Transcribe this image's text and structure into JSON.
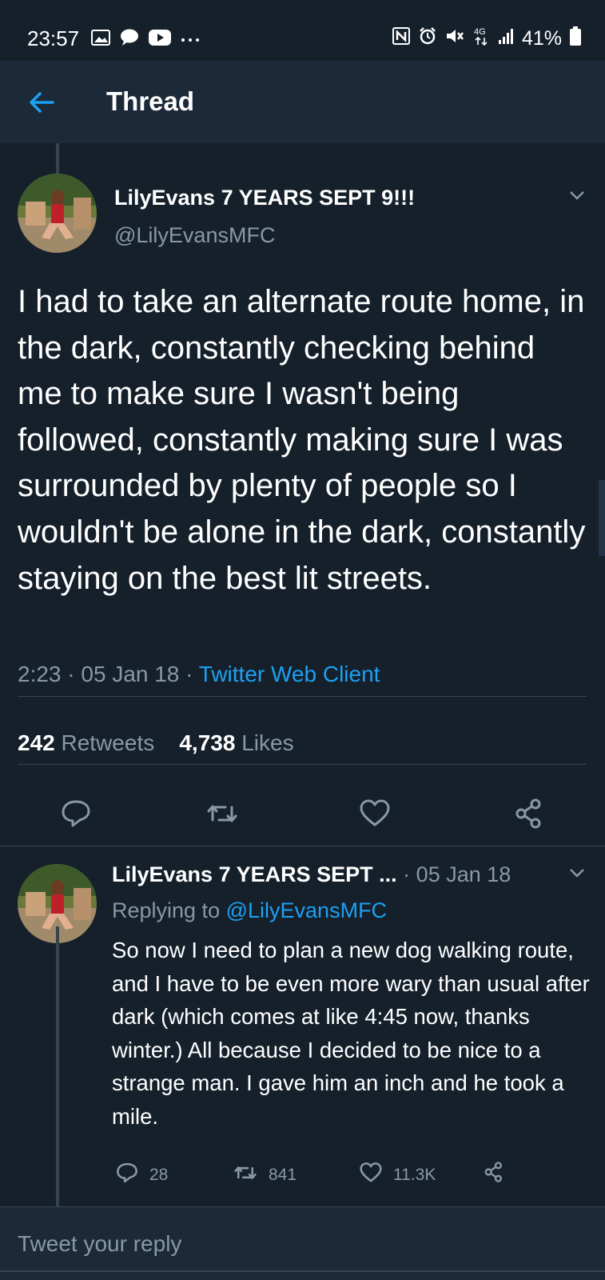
{
  "status_bar": {
    "time": "23:57",
    "left_icons": [
      "image-icon",
      "chat-bubble-icon",
      "youtube-icon",
      "more-icon"
    ],
    "right_icons": [
      "nfc-icon",
      "alarm-icon",
      "mute-icon",
      "4g-icon",
      "signal-icon",
      "battery-icon"
    ],
    "battery": "41%"
  },
  "header": {
    "title": "Thread",
    "accent_color": "#1da1f2"
  },
  "main_tweet": {
    "display_name": "LilyEvans 7 YEARS SEPT 9!!!",
    "handle": "@LilyEvansMFC",
    "text": "I had to take an alternate route home, in the dark, constantly checking behind me to make sure I wasn't being followed, constantly making sure I was surrounded by plenty of people so I wouldn't be alone in the dark, constantly staying on the best lit streets.",
    "time": "2:23",
    "date": "05 Jan 18",
    "client": "Twitter Web Client",
    "retweets_count": "242",
    "retweets_label": "Retweets",
    "likes_count": "4,738",
    "likes_label": "Likes",
    "actions": [
      "reply-icon",
      "retweet-icon",
      "like-icon",
      "share-icon"
    ]
  },
  "reply_tweet": {
    "display_name": "LilyEvans 7 YEARS SEPT ...",
    "date": "05 Jan 18",
    "replying_prefix": "Replying to",
    "replying_handle": "@LilyEvansMFC",
    "text": "So now I need to plan a new dog walking route, and I have to be even more wary than usual after dark (which comes at like 4:45 now, thanks winter.) All because I decided to be nice to a strange man. I gave him an inch and he took a mile.",
    "reply_count": "28",
    "retweet_count": "841",
    "like_count": "11.3K"
  },
  "compose": {
    "placeholder": "Tweet your reply"
  }
}
